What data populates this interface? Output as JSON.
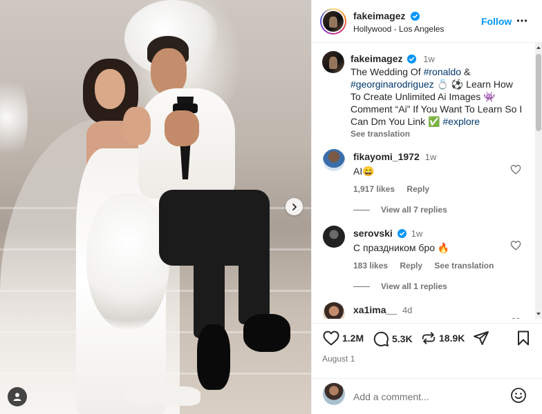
{
  "post": {
    "author": "fakeimagez",
    "location": "Hollywood - Los Angeles",
    "follow_label": "Follow",
    "caption_time": "1w",
    "caption_parts": {
      "p1": "The Wedding Of ",
      "tag1": "#ronaldo",
      "p2": " & ",
      "tag2": "#georginarodriguez",
      "p3": " 💍 ⚽ Learn How To Create Unlimited Ai Images 👾 Comment “Ai” If You Want To Learn So I Can Dm You Link ✅ ",
      "tag3": "#explore"
    },
    "see_translation": "See translation"
  },
  "comments": [
    {
      "username": "fikayomi_1972",
      "time": "1w",
      "text": "AI😄",
      "likes": "1,917 likes",
      "reply": "Reply",
      "view_replies": "View all 7 replies"
    },
    {
      "username": "serovski",
      "time": "1w",
      "text": "С праздником бро 🔥",
      "likes": "183 likes",
      "reply": "Reply",
      "see_translation": "See translation",
      "view_replies": "View all 1 replies"
    },
    {
      "username": "xa1ima__",
      "time": "4d",
      "text": "❤️🔥❤️"
    }
  ],
  "actions": {
    "likes": "1.2M",
    "comments": "5.3K",
    "reposts": "18.9K"
  },
  "date": "August 1",
  "add_comment_placeholder": "Add a comment...",
  "colors": {
    "accent": "#0095f6",
    "hashtag": "#00376b",
    "secondary_text": "#737373",
    "verified": "#0095f6"
  },
  "icons": {
    "verified": "verified-badge-icon",
    "more": "more-options-icon",
    "like": "heart-icon",
    "comment": "comment-icon",
    "repost": "repost-icon",
    "share": "share-icon",
    "save": "bookmark-icon",
    "emoji": "emoji-icon",
    "next": "chevron-right-icon",
    "tag": "user-tag-icon"
  }
}
